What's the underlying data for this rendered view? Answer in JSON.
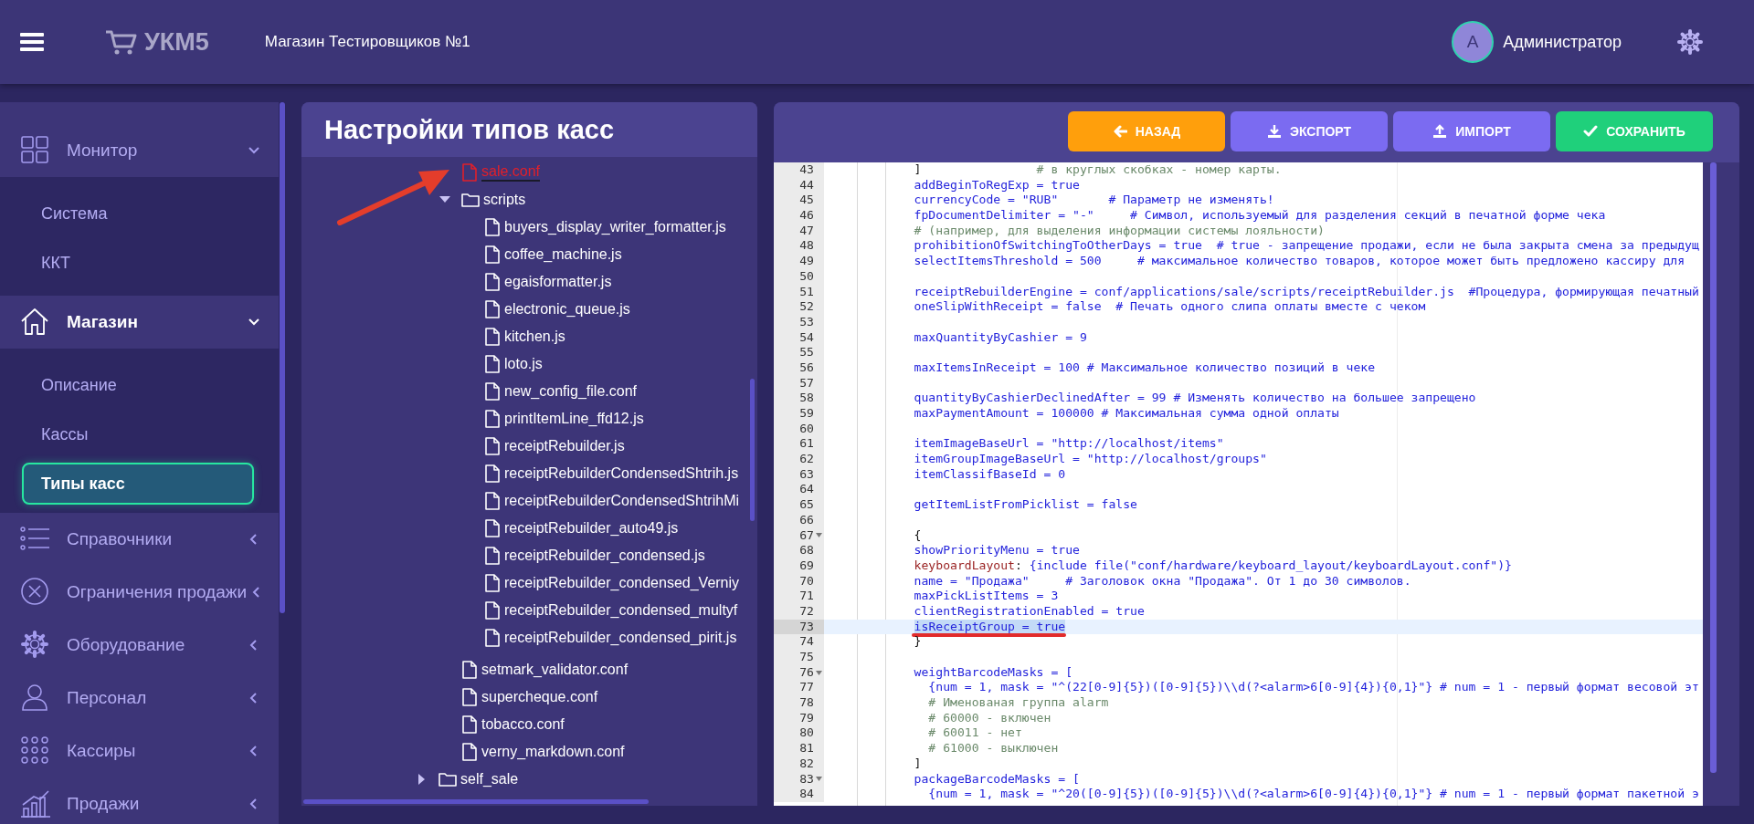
{
  "header": {
    "app_name": "УКМ5",
    "store": "Магазин Тестировщиков №1",
    "user": {
      "initial": "А",
      "name": "Администратор"
    }
  },
  "sidebar": {
    "items": [
      {
        "label": "Монитор",
        "expanded": true,
        "active": false,
        "children": [
          {
            "label": "Система",
            "selected": false
          },
          {
            "label": "ККТ",
            "selected": false
          }
        ]
      },
      {
        "label": "Магазин",
        "expanded": true,
        "active": true,
        "children": [
          {
            "label": "Описание",
            "selected": false
          },
          {
            "label": "Кассы",
            "selected": false
          },
          {
            "label": "Типы касс",
            "selected": true
          }
        ]
      },
      {
        "label": "Справочники",
        "expanded": false,
        "active": false
      },
      {
        "label": "Ограничения продажи",
        "expanded": false,
        "active": false
      },
      {
        "label": "Оборудование",
        "expanded": false,
        "active": false
      },
      {
        "label": "Персонал",
        "expanded": false,
        "active": false
      },
      {
        "label": "Кассиры",
        "expanded": false,
        "active": false
      },
      {
        "label": "Продажи",
        "expanded": false,
        "active": false
      }
    ]
  },
  "tree": {
    "title": "Настройки типов касс",
    "items": [
      {
        "kind": "group",
        "children": [
          {
            "kind": "file",
            "label": "sale.conf",
            "selected": true
          },
          {
            "kind": "folder",
            "label": "scripts",
            "expanded": true,
            "selected": false,
            "children": [
              {
                "kind": "file",
                "label": "buyers_display_writer_formatter.js",
                "selected": false
              },
              {
                "kind": "file",
                "label": "coffee_machine.js",
                "selected": false
              },
              {
                "kind": "file",
                "label": "egaisformatter.js",
                "selected": false
              },
              {
                "kind": "file",
                "label": "electronic_queue.js",
                "selected": false
              },
              {
                "kind": "file",
                "label": "kitchen.js",
                "selected": false
              },
              {
                "kind": "file",
                "label": "loto.js",
                "selected": false
              },
              {
                "kind": "file",
                "label": "new_config_file.conf",
                "selected": false
              },
              {
                "kind": "file",
                "label": "printItemLine_ffd12.js",
                "selected": false
              },
              {
                "kind": "file",
                "label": "receiptRebuilder.js",
                "selected": false
              },
              {
                "kind": "file",
                "label": "receiptRebuilderCondensedShtrih.js",
                "selected": false
              },
              {
                "kind": "file",
                "label": "receiptRebuilderCondensedShtrihMi",
                "selected": false
              },
              {
                "kind": "file",
                "label": "receiptRebuilder_auto49.js",
                "selected": false
              },
              {
                "kind": "file",
                "label": "receiptRebuilder_condensed.js",
                "selected": false
              },
              {
                "kind": "file",
                "label": "receiptRebuilder_condensed_Verniy",
                "selected": false
              },
              {
                "kind": "file",
                "label": "receiptRebuilder_condensed_multyf",
                "selected": false
              },
              {
                "kind": "file",
                "label": "receiptRebuilder_condensed_pirit.js",
                "selected": false
              }
            ]
          },
          {
            "kind": "file",
            "label": "setmark_validator.conf",
            "selected": false
          },
          {
            "kind": "file",
            "label": "supercheque.conf",
            "selected": false
          },
          {
            "kind": "file",
            "label": "tobacco.conf",
            "selected": false
          },
          {
            "kind": "file",
            "label": "verny_markdown.conf",
            "selected": false
          }
        ]
      },
      {
        "kind": "folder",
        "label": "self_sale",
        "expanded": false,
        "selected": false
      }
    ]
  },
  "annotations": [
    {
      "kind": "arrow"
    }
  ],
  "buttons": [
    {
      "label": "НАЗАД",
      "kind": "back"
    },
    {
      "label": "ЭКСПОРТ",
      "kind": "export"
    },
    {
      "label": "ИМПОРТ",
      "kind": "import"
    },
    {
      "label": "СОХРАНИТЬ",
      "kind": "save"
    }
  ],
  "editor": {
    "lines": [
      {
        "n": "43",
        "fold": false,
        "selected": false,
        "parts": [
          {
            "kind": "plain",
            "text": "            ]"
          },
          {
            "kind": "comment",
            "text": "                # в круглых скобках - номер карты."
          }
        ]
      },
      {
        "n": "44",
        "fold": false,
        "selected": false,
        "parts": [
          {
            "kind": "code",
            "text": "            addBeginToRegExp = true"
          }
        ]
      },
      {
        "n": "45",
        "fold": false,
        "selected": false,
        "parts": [
          {
            "kind": "code",
            "text": "            currencyCode = \"RUB\"       # Параметр не изменять!"
          }
        ]
      },
      {
        "n": "46",
        "fold": false,
        "selected": false,
        "parts": [
          {
            "kind": "code",
            "text": "            fpDocumentDelimiter = \"-\"     # Символ, используемый для разделения секций в печатной форме чека"
          }
        ]
      },
      {
        "n": "47",
        "fold": false,
        "selected": false,
        "parts": [
          {
            "kind": "comment",
            "text": "            # (например, для выделения информации системы лояльности)"
          }
        ]
      },
      {
        "n": "48",
        "fold": false,
        "selected": false,
        "parts": [
          {
            "kind": "code",
            "text": "            prohibitionOfSwitchingToOtherDays = true  # true - запрещение продажи, если не была закрыта смена за предыдущ"
          }
        ]
      },
      {
        "n": "49",
        "fold": false,
        "selected": false,
        "parts": [
          {
            "kind": "code",
            "text": "            selectItemsThreshold = 500     # максимальное количество товаров, которое может быть предложено кассиру для"
          }
        ]
      },
      {
        "n": "50",
        "fold": false,
        "selected": false
      },
      {
        "n": "51",
        "fold": false,
        "selected": false,
        "parts": [
          {
            "kind": "code",
            "text": "            receiptRebuilderEngine = conf/applications/sale/scripts/receiptRebuilder.js  #Процедура, формирующая печатный"
          }
        ]
      },
      {
        "n": "52",
        "fold": false,
        "selected": false,
        "parts": [
          {
            "kind": "code",
            "text": "            oneSlipWithReceipt = false  # Печать одного слипа оплаты вместе с чеком"
          }
        ]
      },
      {
        "n": "53",
        "fold": false,
        "selected": false
      },
      {
        "n": "54",
        "fold": false,
        "selected": false,
        "parts": [
          {
            "kind": "code",
            "text": "            maxQuantityByCashier = 9"
          }
        ]
      },
      {
        "n": "55",
        "fold": false,
        "selected": false
      },
      {
        "n": "56",
        "fold": false,
        "selected": false,
        "parts": [
          {
            "kind": "code",
            "text": "            maxItemsInReceipt = 100 # Максимальное количество позиций в чеке"
          }
        ]
      },
      {
        "n": "57",
        "fold": false,
        "selected": false
      },
      {
        "n": "58",
        "fold": false,
        "selected": false,
        "parts": [
          {
            "kind": "code",
            "text": "            quantityByCashierDeclinedAfter = 99 # Изменять количество на большее запрещено"
          }
        ]
      },
      {
        "n": "59",
        "fold": false,
        "selected": false,
        "parts": [
          {
            "kind": "code",
            "text": "            maxPaymentAmount = 100000 # Максимальная сумма одной оплаты"
          }
        ]
      },
      {
        "n": "60",
        "fold": false,
        "selected": false
      },
      {
        "n": "61",
        "fold": false,
        "selected": false,
        "parts": [
          {
            "kind": "code",
            "text": "            itemImageBaseUrl = \"http://localhost/items\""
          }
        ]
      },
      {
        "n": "62",
        "fold": false,
        "selected": false,
        "parts": [
          {
            "kind": "code",
            "text": "            itemGroupImageBaseUrl = \"http://localhost/groups\""
          }
        ]
      },
      {
        "n": "63",
        "fold": false,
        "selected": false,
        "parts": [
          {
            "kind": "code",
            "text": "            itemClassifBaseId = 0"
          }
        ]
      },
      {
        "n": "64",
        "fold": false,
        "selected": false
      },
      {
        "n": "65",
        "fold": false,
        "selected": false,
        "parts": [
          {
            "kind": "code",
            "text": "            getItemListFromPicklist = false"
          }
        ]
      },
      {
        "n": "66",
        "fold": false,
        "selected": false
      },
      {
        "n": "67",
        "fold": true,
        "selected": false,
        "parts": [
          {
            "kind": "plain",
            "text": "            {"
          }
        ]
      },
      {
        "n": "68",
        "fold": false,
        "selected": false,
        "parts": [
          {
            "kind": "code",
            "text": "            showPriorityMenu = true"
          }
        ]
      },
      {
        "n": "69",
        "fold": false,
        "selected": false,
        "parts": [
          {
            "kind": "key",
            "text": "            keyboardLayout"
          },
          {
            "kind": "plain",
            "text": ": "
          },
          {
            "kind": "code",
            "text": "{include file(\"conf/hardware/keyboard_layout/keyboardLayout.conf\")}"
          }
        ]
      },
      {
        "n": "70",
        "fold": false,
        "selected": false,
        "parts": [
          {
            "kind": "code",
            "text": "            name = \"Продажа\"     # Заголовок окна \"Продажа\". От 1 до 30 символов."
          }
        ]
      },
      {
        "n": "71",
        "fold": false,
        "selected": false,
        "parts": [
          {
            "kind": "code",
            "text": "            maxPickListItems = 3"
          }
        ]
      },
      {
        "n": "72",
        "fold": false,
        "selected": false,
        "parts": [
          {
            "kind": "code",
            "text": "            clientRegistrationEnabled = true"
          }
        ]
      },
      {
        "n": "73",
        "fold": false,
        "selected": true,
        "parts": [
          {
            "kind": "sel",
            "text": "            isReceiptGroup = true"
          }
        ]
      },
      {
        "n": "74",
        "fold": false,
        "selected": false,
        "parts": [
          {
            "kind": "plain",
            "text": "            }"
          }
        ]
      },
      {
        "n": "75",
        "fold": false,
        "selected": false
      },
      {
        "n": "76",
        "fold": true,
        "selected": false,
        "parts": [
          {
            "kind": "code",
            "text": "            weightBarcodeMasks = ["
          }
        ]
      },
      {
        "n": "77",
        "fold": false,
        "selected": false,
        "parts": [
          {
            "kind": "code",
            "text": "              {num = 1, mask = \"^(22[0-9]{5})([0-9]{5})\\\\d(?<alarm>6[0-9]{4}){0,1}\"} # num = 1 - первый формат весовой эт"
          }
        ]
      },
      {
        "n": "78",
        "fold": false,
        "selected": false,
        "parts": [
          {
            "kind": "comment",
            "text": "              # Именованая группа alarm"
          }
        ]
      },
      {
        "n": "79",
        "fold": false,
        "selected": false,
        "parts": [
          {
            "kind": "comment",
            "text": "              # 60000 - включен"
          }
        ]
      },
      {
        "n": "80",
        "fold": false,
        "selected": false,
        "parts": [
          {
            "kind": "comment",
            "text": "              # 60011 - нет"
          }
        ]
      },
      {
        "n": "81",
        "fold": false,
        "selected": false,
        "parts": [
          {
            "kind": "comment",
            "text": "              # 61000 - выключен"
          }
        ]
      },
      {
        "n": "82",
        "fold": false,
        "selected": false,
        "parts": [
          {
            "kind": "plain",
            "text": "            ]"
          }
        ]
      },
      {
        "n": "83",
        "fold": true,
        "selected": false,
        "parts": [
          {
            "kind": "code",
            "text": "            packageBarcodeMasks = ["
          }
        ]
      },
      {
        "n": "84",
        "fold": false,
        "selected": false,
        "parts": [
          {
            "kind": "code",
            "text": "              {num = 1, mask = \"^20([0-9]{5})([0-9]{5})\\\\d(?<alarm>6[0-9]{4}){0,1}\"} # num = 1 - первый формат пакетной э"
          }
        ]
      }
    ]
  }
}
